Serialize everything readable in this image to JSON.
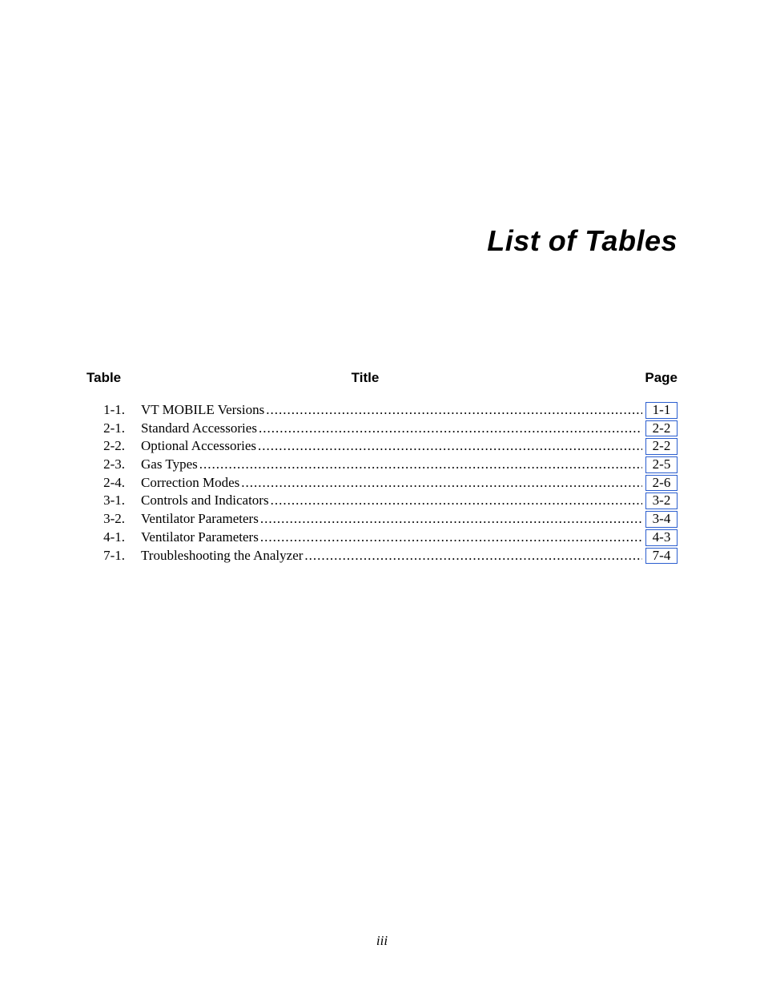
{
  "title": "List of Tables",
  "headers": {
    "table": "Table",
    "title": "Title",
    "page": "Page"
  },
  "entries": [
    {
      "num": "1-1.",
      "title": "VT MOBILE Versions",
      "page": "1-1"
    },
    {
      "num": "2-1.",
      "title": "Standard Accessories",
      "page": "2-2"
    },
    {
      "num": "2-2.",
      "title": "Optional Accessories",
      "page": "2-2"
    },
    {
      "num": "2-3.",
      "title": "Gas Types",
      "page": "2-5"
    },
    {
      "num": "2-4.",
      "title": "Correction Modes",
      "page": "2-6"
    },
    {
      "num": "3-1.",
      "title": "Controls and Indicators",
      "page": "3-2"
    },
    {
      "num": "3-2.",
      "title": "Ventilator Parameters",
      "page": "3-4"
    },
    {
      "num": "4-1.",
      "title": "Ventilator Parameters",
      "page": "4-3"
    },
    {
      "num": "7-1.",
      "title": "Troubleshooting the Analyzer",
      "page": "7-4"
    }
  ],
  "pageNumber": "iii"
}
